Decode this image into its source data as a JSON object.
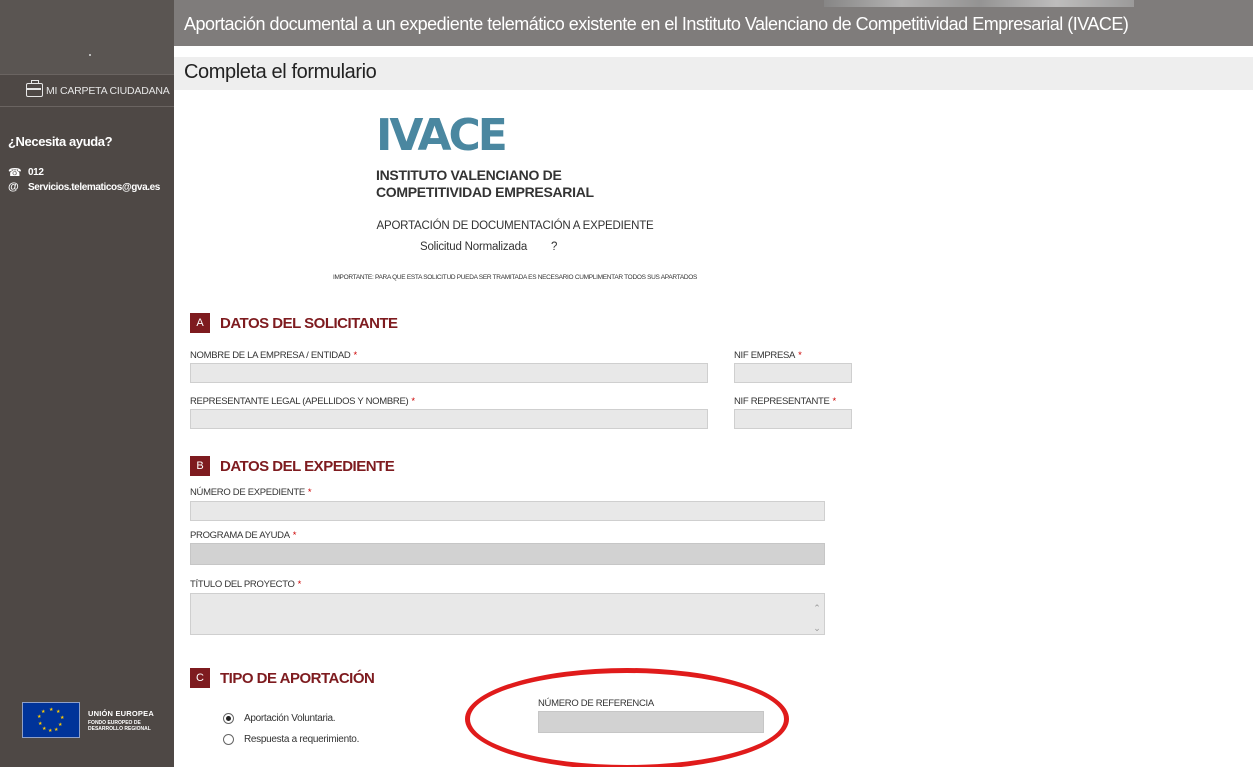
{
  "sidebar": {
    "carpeta_label": "MI CARPETA CIUDADANA",
    "help_title": "¿Necesita ayuda?",
    "phone": "012",
    "email": "Servicios.telematicos@gva.es",
    "eu_title": "UNIÓN EUROPEA",
    "eu_subtitle_1": "FONDO EUROPEO DE",
    "eu_subtitle_2": "DESARROLLO REGIONAL"
  },
  "header": {
    "title": "Aportación documental a un expediente telemático existente en el Instituto Valenciano de Competitividad Empresarial (IVACE)",
    "subtitle": "Completa el formulario"
  },
  "logo": {
    "word": "IVACE",
    "line1": "INSTITUTO VALENCIANO DE",
    "line2": "COMPETITIVIDAD EMPRESARIAL"
  },
  "form": {
    "doc_title": "APORTACIÓN DE DOCUMENTACIÓN A EXPEDIENTE",
    "doc_sub": "Solicitud Normalizada",
    "help_mark": "?",
    "important": "IMPORTANTE: PARA QUE ESTA SOLICITUD PUEDA SER TRAMITADA ES NECESARIO CUMPLIMENTAR TODOS SUS APARTADOS",
    "required_mark": "*",
    "section_a": {
      "letter": "A",
      "name": "DATOS DEL SOLICITANTE"
    },
    "nombre_empresa": "NOMBRE DE LA EMPRESA / ENTIDAD",
    "nif_empresa": "NIF EMPRESA",
    "representante": "REPRESENTANTE LEGAL (APELLIDOS Y NOMBRE)",
    "nif_representante": "NIF REPRESENTANTE",
    "section_b": {
      "letter": "B",
      "name": "DATOS DEL EXPEDIENTE"
    },
    "numero_expediente": "NÚMERO DE EXPEDIENTE",
    "programa_ayuda": "PROGRAMA DE AYUDA",
    "titulo_proyecto": "TÍTULO DEL PROYECTO",
    "section_c": {
      "letter": "C",
      "name": "TIPO DE APORTACIÓN"
    },
    "radio_voluntaria": "Aportación Voluntaria.",
    "radio_requerimiento": "Respuesta a requerimiento.",
    "numero_referencia": "NÚMERO DE REFERENCIA"
  },
  "colors": {
    "accent": "#7e1b1f",
    "sidebar": "#4e4845",
    "header": "#7f7c7b",
    "highlight": "#e01b1b"
  }
}
